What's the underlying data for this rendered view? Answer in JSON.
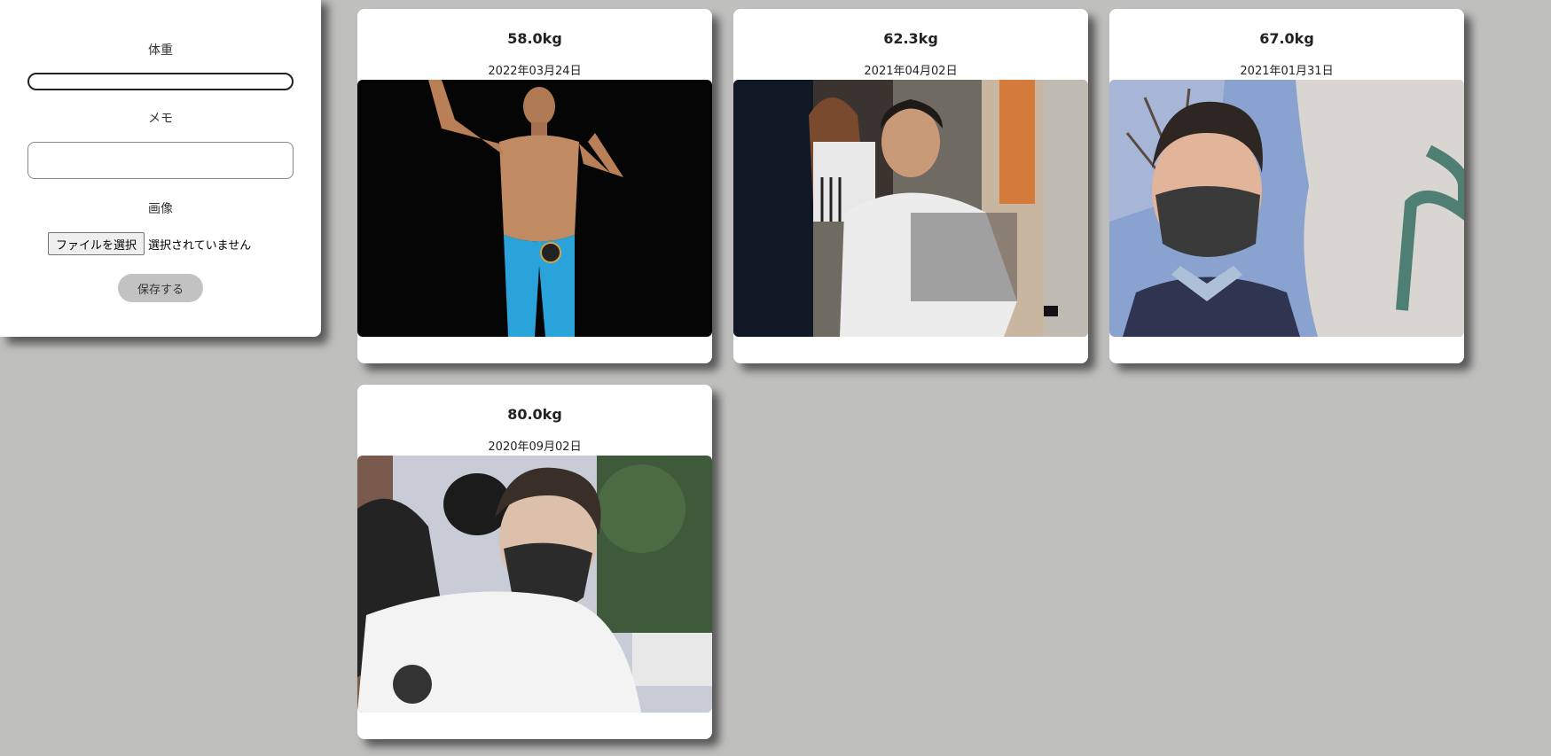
{
  "form": {
    "weight_label": "体重",
    "weight_value": "",
    "memo_label": "メモ",
    "memo_value": "",
    "image_label": "画像",
    "file_button_label": "ファイルを選択",
    "file_status": "選択されていません",
    "save_label": "保存する"
  },
  "records": [
    {
      "weight": "58.0kg",
      "date": "2022年03月24日"
    },
    {
      "weight": "62.3kg",
      "date": "2021年04月02日"
    },
    {
      "weight": "67.0kg",
      "date": "2021年01月31日"
    },
    {
      "weight": "80.0kg",
      "date": "2020年09月02日"
    }
  ]
}
